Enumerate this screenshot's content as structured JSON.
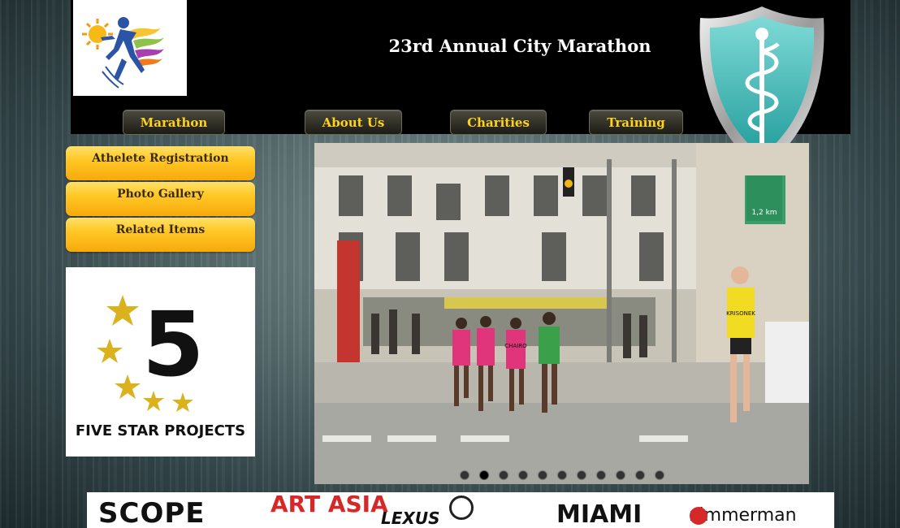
{
  "header": {
    "title": "23rd Annual City Marathon"
  },
  "nav": [
    {
      "label": "Marathon"
    },
    {
      "label": "About Us"
    },
    {
      "label": "Charities"
    },
    {
      "label": "Training"
    }
  ],
  "sidebar": [
    {
      "label": "Athelete Registration"
    },
    {
      "label": "Photo Gallery"
    },
    {
      "label": "Related Items"
    }
  ],
  "fivestar": {
    "number": "5",
    "label": "FIVE STAR PROJECTS"
  },
  "slideshow": {
    "slide_count": 11,
    "active_slide": 2,
    "bib_labels": [
      "CHAIRO",
      "KRISONEK"
    ],
    "street_sign": "1,2 km"
  },
  "sponsors": [
    {
      "name": "SCOPE"
    },
    {
      "name": "ART ASIA"
    },
    {
      "name": "LEXUS"
    },
    {
      "name": "MIAMI"
    },
    {
      "name": "zimmerman"
    }
  ],
  "colors": {
    "header_bg": "#000000",
    "nav_text": "#ffd21c",
    "side_button": "#ffc825",
    "shield": "#3cb9b9"
  }
}
